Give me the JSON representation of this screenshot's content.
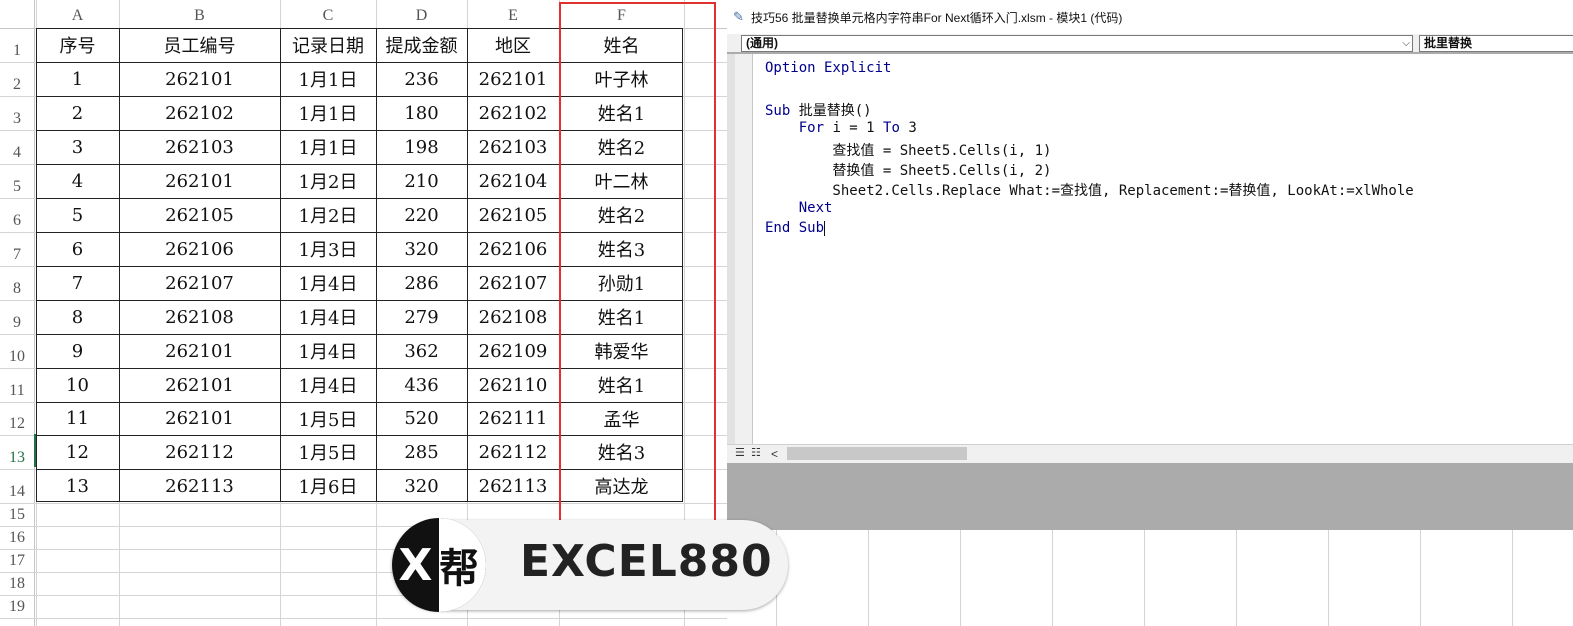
{
  "spreadsheet": {
    "columns": [
      "A",
      "B",
      "C",
      "D",
      "E",
      "F"
    ],
    "rows": [
      "1",
      "2",
      "3",
      "4",
      "5",
      "6",
      "7",
      "8",
      "9",
      "10",
      "11",
      "12",
      "13",
      "14",
      "15",
      "16",
      "17",
      "18",
      "19"
    ],
    "table": {
      "headers": [
        "序号",
        "员工编号",
        "记录日期",
        "提成金额",
        "地区",
        "姓名"
      ],
      "data": [
        [
          "1",
          "262101",
          "1月1日",
          "236",
          "262101",
          "叶子林"
        ],
        [
          "2",
          "262102",
          "1月1日",
          "180",
          "262102",
          "姓名1"
        ],
        [
          "3",
          "262103",
          "1月1日",
          "198",
          "262103",
          "姓名2"
        ],
        [
          "4",
          "262101",
          "1月2日",
          "210",
          "262104",
          "叶二林"
        ],
        [
          "5",
          "262105",
          "1月2日",
          "220",
          "262105",
          "姓名2"
        ],
        [
          "6",
          "262106",
          "1月3日",
          "320",
          "262106",
          "姓名3"
        ],
        [
          "7",
          "262107",
          "1月4日",
          "286",
          "262107",
          "孙勋1"
        ],
        [
          "8",
          "262108",
          "1月4日",
          "279",
          "262108",
          "姓名1"
        ],
        [
          "9",
          "262101",
          "1月4日",
          "362",
          "262109",
          "韩爱华"
        ],
        [
          "10",
          "262101",
          "1月4日",
          "436",
          "262110",
          "姓名1"
        ],
        [
          "11",
          "262101",
          "1月5日",
          "520",
          "262111",
          "孟华"
        ],
        [
          "12",
          "262112",
          "1月5日",
          "285",
          "262112",
          "姓名3"
        ],
        [
          "13",
          "262113",
          "1月6日",
          "320",
          "262113",
          "高达龙"
        ]
      ]
    },
    "active_row": "13",
    "highlight_color": "#e03030"
  },
  "vba_editor": {
    "title": "技巧56 批量替换单元格内字符串For Next循环入门.xlsm - 模块1 (代码)",
    "title_icon": "vba-module-icon",
    "object_combo": "(通用)",
    "procedure_combo": "批里替换",
    "code_lines": [
      [
        {
          "t": "Option Explicit",
          "k": true
        }
      ],
      [],
      [
        {
          "t": "Sub",
          "k": true
        },
        {
          "t": " 批量替换()",
          "k": false
        }
      ],
      [
        {
          "t": "    ",
          "k": false
        },
        {
          "t": "For",
          "k": true
        },
        {
          "t": " i = 1 ",
          "k": false
        },
        {
          "t": "To",
          "k": true
        },
        {
          "t": " 3",
          "k": false
        }
      ],
      [
        {
          "t": "        查找值 = Sheet5.Cells(i, 1)",
          "k": false
        }
      ],
      [
        {
          "t": "        替换值 = Sheet5.Cells(i, 2)",
          "k": false
        }
      ],
      [
        {
          "t": "        Sheet2.Cells.Replace What:=查找值, Replacement:=替换值, LookAt:=xlWhole",
          "k": false
        }
      ],
      [
        {
          "t": "    ",
          "k": false
        },
        {
          "t": "Next",
          "k": true
        }
      ],
      [
        {
          "t": "End Sub",
          "k": true
        }
      ]
    ],
    "keyword_color": "#00008b"
  },
  "watermark": {
    "badge_left": "X",
    "badge_right": "帮",
    "text": "EXCEL880"
  }
}
